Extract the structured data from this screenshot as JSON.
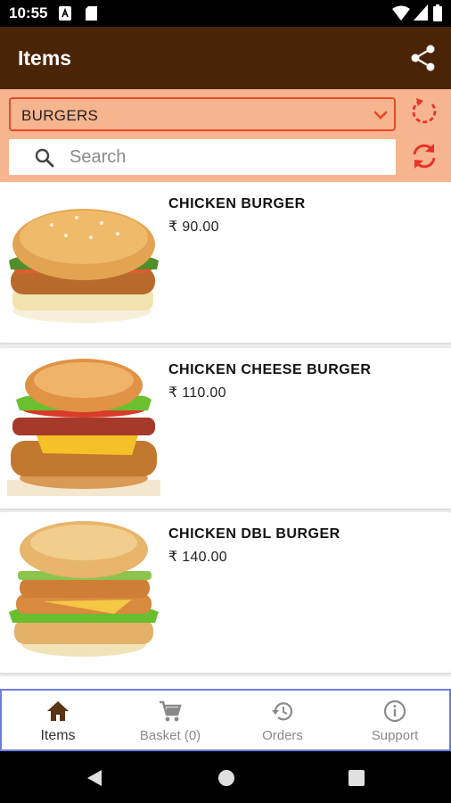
{
  "status_bar": {
    "time": "10:55"
  },
  "app_bar": {
    "title": "Items",
    "share_icon": "share-icon"
  },
  "filters": {
    "category_selected": "BURGERS",
    "search_placeholder": "Search",
    "search_value": ""
  },
  "items": [
    {
      "name": "CHICKEN BURGER",
      "price": "₹ 90.00"
    },
    {
      "name": "CHICKEN CHEESE BURGER",
      "price": "₹ 110.00"
    },
    {
      "name": "CHICKEN DBL BURGER",
      "price": "₹ 140.00"
    }
  ],
  "bottom_nav": [
    {
      "label": "Items",
      "icon": "home-icon",
      "active": true
    },
    {
      "label": "Basket (0)",
      "icon": "cart-icon",
      "active": false
    },
    {
      "label": "Orders",
      "icon": "history-icon",
      "active": false
    },
    {
      "label": "Support",
      "icon": "info-icon",
      "active": false
    }
  ],
  "colors": {
    "app_bar": "#4a2407",
    "filter_bg": "#f6b58e",
    "accent": "#e8492a",
    "nav_border": "#6b7ee0"
  }
}
